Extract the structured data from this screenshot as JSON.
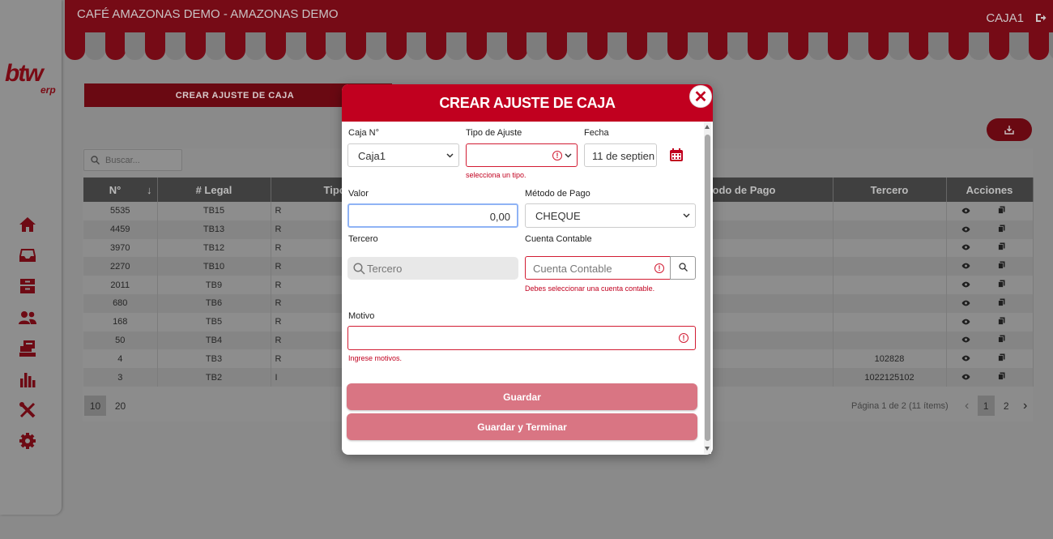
{
  "app": {
    "company_title": "CAFÉ AMAZONAS DEMO - AMAZONAS DEMO",
    "user": "CAJA1",
    "logo_main": "btw",
    "logo_sub": "erp"
  },
  "sidebar": {
    "icons": [
      "home-icon",
      "inbox-icon",
      "archive-icon",
      "users-icon",
      "register-icon",
      "chart-icon",
      "tools-icon",
      "gear-icon"
    ]
  },
  "page": {
    "create_button": "CREAR AJUSTE DE CAJA",
    "search_placeholder": "Buscar...",
    "columns": [
      "N°",
      "# Legal",
      "Tipo",
      "Método de Pago",
      "Tercero",
      "Acciones"
    ],
    "rows": [
      {
        "n": "5535",
        "legal": "TB15",
        "tipo": "R",
        "tercero": ""
      },
      {
        "n": "4459",
        "legal": "TB13",
        "tipo": "R",
        "tercero": ""
      },
      {
        "n": "3970",
        "legal": "TB12",
        "tipo": "R",
        "tercero": ""
      },
      {
        "n": "2270",
        "legal": "TB10",
        "tipo": "R",
        "tercero": ""
      },
      {
        "n": "2011",
        "legal": "TB9",
        "tipo": "R",
        "tercero": ""
      },
      {
        "n": "680",
        "legal": "TB6",
        "tipo": "R",
        "tercero": ""
      },
      {
        "n": "168",
        "legal": "TB5",
        "tipo": "R",
        "tercero": ""
      },
      {
        "n": "50",
        "legal": "TB4",
        "tipo": "R",
        "tercero": ""
      },
      {
        "n": "4",
        "legal": "TB3",
        "tipo": "R",
        "tercero": "102828"
      },
      {
        "n": "3",
        "legal": "TB2",
        "tipo": "I",
        "tercero": "1022125102"
      }
    ],
    "page_sizes": [
      "10",
      "20"
    ],
    "page_info": "Página 1 de 2 (11 ítems)",
    "pages": [
      "1",
      "2"
    ]
  },
  "modal": {
    "title": "CREAR AJUSTE DE CAJA",
    "caja_label": "Caja N°",
    "caja_value": "Caja1",
    "tipo_label": "Tipo de Ajuste",
    "tipo_error": "selecciona un tipo.",
    "fecha_label": "Fecha",
    "fecha_value": "11 de septien",
    "valor_label": "Valor",
    "valor_value": "0,00",
    "metodo_label": "Método de Pago",
    "metodo_value": "CHEQUE",
    "tercero_label": "Tercero",
    "tercero_placeholder": "Tercero",
    "cuenta_label": "Cuenta Contable",
    "cuenta_placeholder": "Cuenta Contable",
    "cuenta_error": "Debes seleccionar una cuenta contable.",
    "motivo_label": "Motivo",
    "motivo_error": "Ingrese motivos.",
    "save_label": "Guardar",
    "save_finish_label": "Guardar y Terminar"
  },
  "colors": {
    "brand": "#c1001f",
    "brand_dark": "#760b16",
    "button_disabled": "#d97583",
    "error": "#d21c33"
  }
}
